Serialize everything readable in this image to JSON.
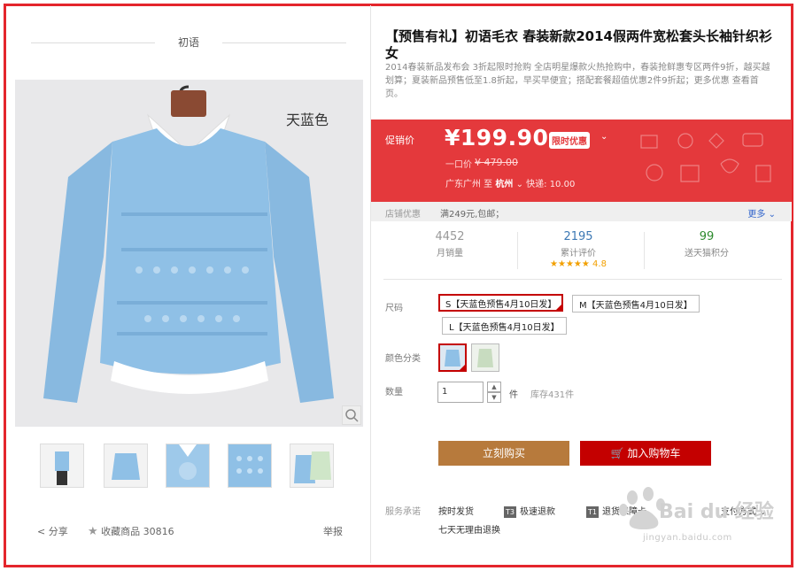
{
  "brand": {
    "name": "初语"
  },
  "product": {
    "color_overlay": "天蓝色",
    "title": "【预售有礼】初语毛衣 春装新款2014假两件宽松套头长袖针织衫女",
    "subtitle": "2014春装新品发布会 3折起限时抢购 全店明星爆款火热抢购中，春装抢鲜惠专区两件9折，越买越划算；夏装新品预售低至1.8折起，早买早便宜；搭配套餐超值优惠2件9折起；更多优惠 查看首页。"
  },
  "gallery": {
    "thumb_count": 5
  },
  "actions": {
    "share": "分享",
    "favorite": "收藏商品 30816",
    "report": "举报"
  },
  "price": {
    "label": "促销价",
    "value": "¥199.90",
    "badge": "限时优惠",
    "original_label": "一口价",
    "original": "¥ 479.00",
    "ship_from": "广东广州 至",
    "ship_to": "杭州",
    "ship_fee": "快递: 10.00"
  },
  "promo": {
    "label": "店铺优惠",
    "value": "满249元,包邮；",
    "more": "更多"
  },
  "stats": [
    {
      "num": "4452",
      "caption": "月销量",
      "color": "#999999"
    },
    {
      "num": "2195",
      "caption": "累计评价",
      "color": "#3c78b4",
      "rating": "4.8"
    },
    {
      "num": "99",
      "caption": "送天猫积分",
      "color": "#2e8b2e"
    }
  ],
  "options": {
    "size_label": "尺码",
    "sizes": [
      "S【天蓝色预售4月10日发】",
      "M【天蓝色预售4月10日发】",
      "L【天蓝色预售4月10日发】"
    ],
    "color_label": "颜色分类",
    "qty_label": "数量",
    "qty_value": "1",
    "qty_unit": "件",
    "stock": "库存431件"
  },
  "buttons": {
    "buy": "立刻购买",
    "cart": "加入购物车"
  },
  "service": {
    "label": "服务承诺",
    "items": [
      "按时发货",
      "极速退款",
      "退货保障卡",
      "支付方式"
    ],
    "tags": [
      "T3",
      "T1"
    ],
    "return_policy": "七天无理由退换"
  },
  "watermark": {
    "logo": "Bai du 经验",
    "url": "jingyan.baidu.com"
  },
  "colors": {
    "accent": "#e4393c",
    "selected": "#c40000",
    "buy": "#b77a3c"
  }
}
